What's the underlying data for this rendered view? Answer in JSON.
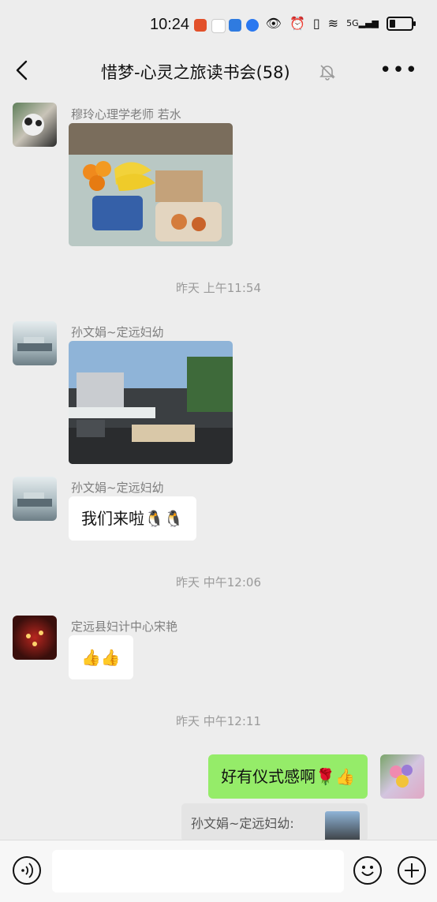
{
  "status_bar": {
    "time": "10:24",
    "network_label": "5G"
  },
  "header": {
    "title": "惜梦-心灵之旅读书会(58)"
  },
  "messages": [
    {
      "sender": "穆玲心理学老师  若水"
    },
    {
      "timestamp": "昨天 上午11:54"
    },
    {
      "sender": "孙文娟~定远妇幼"
    },
    {
      "sender": "孙文娟~定远妇幼",
      "text": "我们来啦🐧🐧"
    },
    {
      "timestamp": "昨天 中午12:06"
    },
    {
      "sender": "定远县妇计中心宋艳",
      "text": "👍👍"
    },
    {
      "timestamp": "昨天 中午12:11"
    },
    {
      "text": "好有仪式感啊🌹👍",
      "quote": "孙文娟~定远妇幼:"
    }
  ],
  "colors": {
    "accent": "#95ec69",
    "background": "#ededed"
  }
}
